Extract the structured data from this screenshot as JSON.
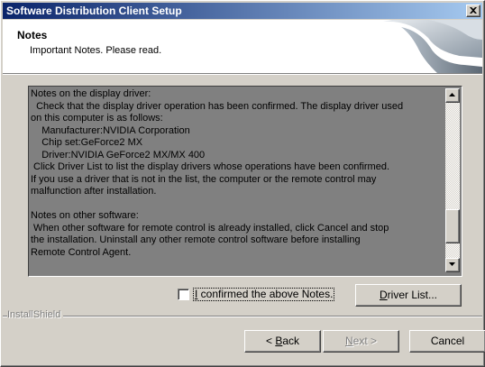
{
  "window": {
    "title": "Software Distribution Client Setup"
  },
  "header": {
    "title": "Notes",
    "subtitle": "Important Notes. Please read."
  },
  "notes": {
    "lines": [
      "Notes on the display driver:",
      "  Check that the display driver operation has been confirmed. The display driver used",
      "on this computer is as follows:",
      "    Manufacturer:NVIDIA Corporation",
      "    Chip set:GeForce2 MX",
      "    Driver:NVIDIA GeForce2 MX/MX 400",
      " Click Driver List to list the display drivers whose operations have been confirmed.",
      "If you use a driver that is not in the list, the computer or the remote control may",
      "malfunction after installation.",
      "",
      "Notes on other software:",
      " When other software for remote control is already installed, click Cancel and stop",
      "the installation. Uninstall any other remote control software before installing",
      "Remote Control Agent."
    ],
    "scroll_position": 0.88,
    "scroll_visible_fraction": 0.22
  },
  "confirm": {
    "checked": false,
    "label_underlined": "I",
    "label_rest": " confirmed the above Notes."
  },
  "buttons": {
    "driver_list_underlined": "D",
    "driver_list_rest": "river List...",
    "back_prefix": "< ",
    "back_underlined": "B",
    "back_rest": "ack",
    "next_underlined": "N",
    "next_rest": "ext >",
    "cancel": "Cancel"
  },
  "footer": {
    "brand": "InstallShield"
  },
  "icons": {
    "close": "close-icon",
    "scroll_up": "arrow-up-icon",
    "scroll_down": "arrow-down-icon",
    "header_graphic": "installshield-wizard-graphic"
  },
  "colors": {
    "title_start": "#0a246a",
    "title_end": "#a6caf0",
    "dialog_face": "#d4d0c8",
    "notes_background": "#808080"
  }
}
